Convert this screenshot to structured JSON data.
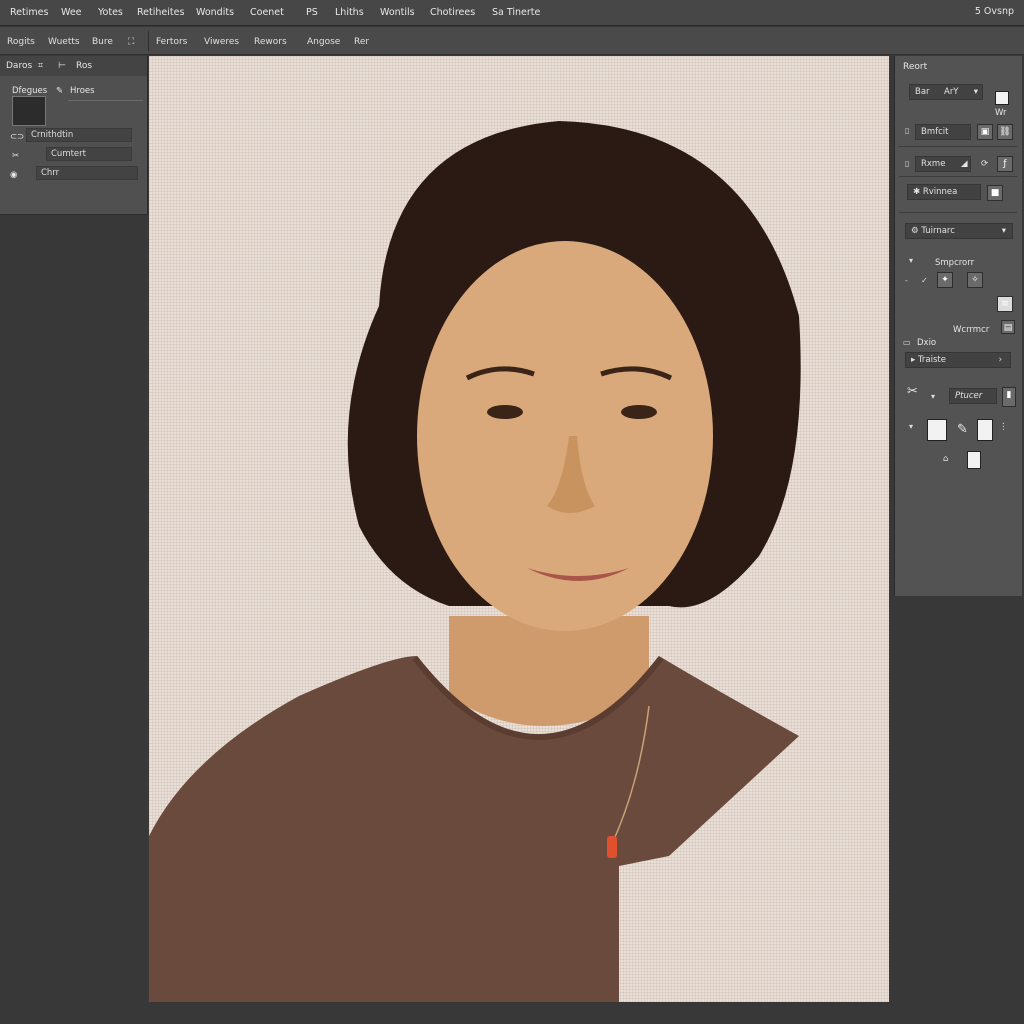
{
  "menubar": {
    "items": [
      "Retimes",
      "Wee",
      "Yotes",
      "Retiheites",
      "Wondits",
      "Coenet",
      "PS",
      "Lhiths",
      "Wontils",
      "Chotirees",
      "Sa Tinerte"
    ],
    "right": "5 Ovsnp"
  },
  "options": {
    "left": [
      "Rogits",
      "Wuetts",
      "Bure"
    ],
    "right": [
      "Fertors",
      "Viweres",
      "Rewors",
      "Angose",
      "Rer"
    ]
  },
  "leftpanel": {
    "tabs": [
      "Daros",
      "Ros"
    ],
    "header_left": "Dfegues",
    "header_right": "Hroes",
    "rows": [
      "Crnithdtin",
      "Cumtert",
      "Chrr"
    ]
  },
  "rightpanel": {
    "title": "Reort",
    "row1_left": "Bar",
    "row1_right": "ArY",
    "row1_note": "Wr",
    "row2": "Bmfcit",
    "row3": "Rxme",
    "row4": "Rvinnea",
    "row5": "Tuirnarc",
    "row6": "Smpcrorr",
    "row7": "Wcrrmcr",
    "row8": "Dxio",
    "row9": "Traiste",
    "row10": "Ptucer"
  },
  "colors": {
    "canvas_bg": "#e9dfd6",
    "shirt": "#6a4a3c",
    "hair": "#2b1a13",
    "skin": "#d9a97c",
    "pendant": "#e0502e"
  }
}
